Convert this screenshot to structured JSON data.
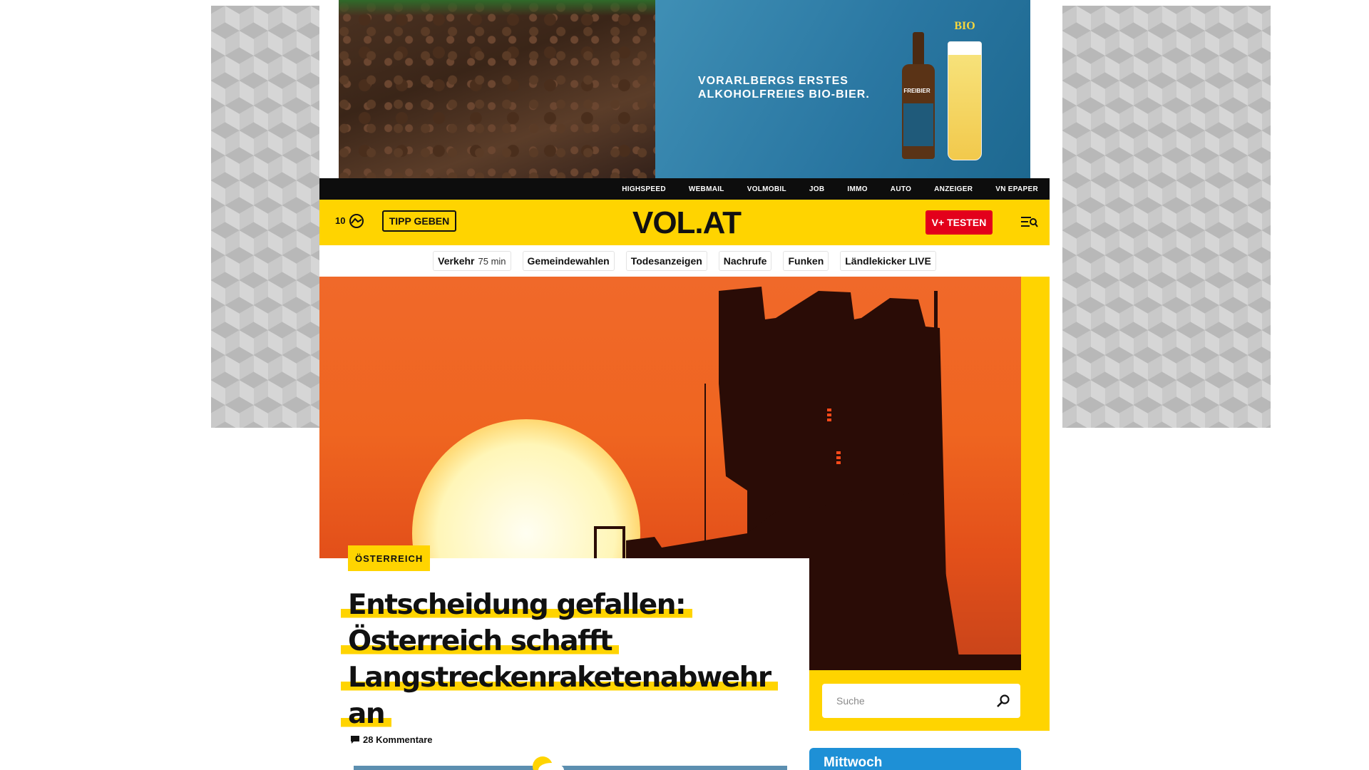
{
  "ad": {
    "line1": "VORARLBERGS ERSTES",
    "line2": "ALKOHOLFREIES BIO-BIER.",
    "bio_badge": "BIO",
    "bottle_label": "FREIBIER",
    "colors": {
      "panel": "#2a77a2",
      "text": "#ffffff"
    }
  },
  "topnav": {
    "items": [
      "HIGHSPEED",
      "WEBMAIL",
      "VOLMOBIL",
      "JOB",
      "IMMO",
      "AUTO",
      "ANZEIGER",
      "VN EPAPER"
    ]
  },
  "header": {
    "temperature": "10",
    "weather_icon": "cloud-sun-icon",
    "tip_button": "TIPP GEBEN",
    "logo": "VOL.AT",
    "vplus_button": "V+ TESTEN",
    "menu_icon": "menu-search-icon",
    "colors": {
      "background": "#ffd400",
      "vplus": "#e3001b"
    }
  },
  "quicklinks": [
    {
      "label": "Verkehr",
      "extra": "75 min"
    },
    {
      "label": "Gemeindewahlen",
      "extra": ""
    },
    {
      "label": "Todesanzeigen",
      "extra": ""
    },
    {
      "label": "Nachrufe",
      "extra": ""
    },
    {
      "label": "Funken",
      "extra": ""
    },
    {
      "label": "Ländlekicker LIVE",
      "extra": ""
    }
  ],
  "article": {
    "category": "ÖSTERREICH",
    "headline_lines": [
      "Entscheidung gefallen:",
      "Österreich schafft",
      "Langstreckenraketenabwehr",
      "an"
    ],
    "comments": "28 Kommentare",
    "comment_icon": "comment-icon"
  },
  "search": {
    "placeholder": "Suche",
    "icon": "search-icon"
  },
  "weather_widget": {
    "day": "Mittwoch"
  }
}
